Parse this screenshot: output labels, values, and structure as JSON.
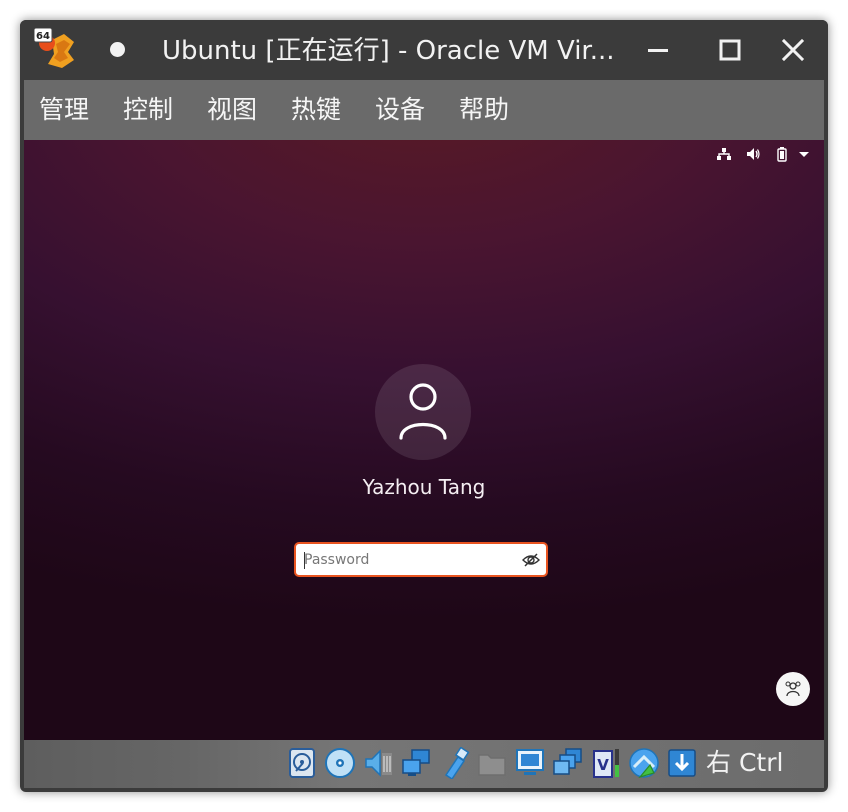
{
  "window": {
    "title": "Ubuntu [正在运行] - Oracle VM Vir...",
    "app_icon_badge": "64"
  },
  "menu": {
    "items": [
      "管理",
      "控制",
      "视图",
      "热键",
      "设备",
      "帮助"
    ]
  },
  "login": {
    "username": "Yazhou Tang",
    "password_placeholder": "Password",
    "password_value": ""
  },
  "status_bar": {
    "host_key": "右 Ctrl",
    "icons": [
      "hard-disk-icon",
      "optical-drive-icon",
      "audio-icon",
      "network-icon",
      "usb-icon",
      "shared-folders-icon",
      "display-icon",
      "video-capture-icon",
      "virtualization-icon",
      "mouse-integration-icon",
      "keyboard-capture-icon"
    ]
  },
  "top_panel": {
    "icons": [
      "network-wired-icon",
      "volume-icon",
      "battery-icon",
      "system-menu-chevron-icon"
    ]
  },
  "colors": {
    "accent": "#e95420",
    "titlebar": "#3b3b3b",
    "menubar": "#6a6a6a"
  }
}
